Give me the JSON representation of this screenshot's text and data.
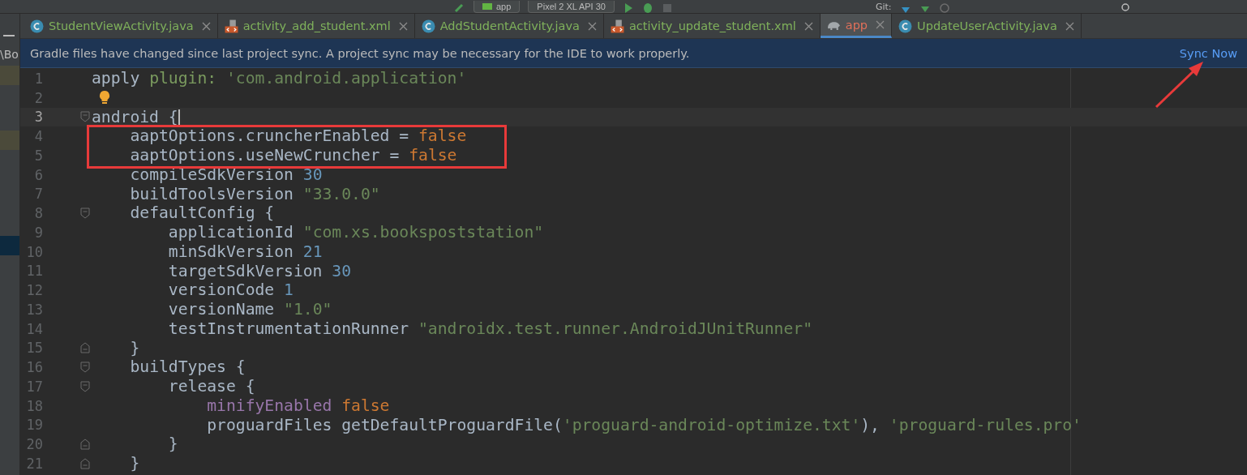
{
  "toolbar": {
    "config": "app",
    "device": "Pixel 2 XL API 30",
    "vcs": "Git:"
  },
  "side_panel": {
    "path_fragment": "\\Bo"
  },
  "tabs": [
    {
      "label": "StudentViewActivity.java",
      "kind": "class",
      "color": "#7fb15b",
      "selected": false
    },
    {
      "label": "activity_add_student.xml",
      "kind": "xml",
      "color": "#7fb15b",
      "selected": false
    },
    {
      "label": "AddStudentActivity.java",
      "kind": "class",
      "color": "#7fb15b",
      "selected": false
    },
    {
      "label": "activity_update_student.xml",
      "kind": "xml",
      "color": "#7fb15b",
      "selected": false
    },
    {
      "label": "app",
      "kind": "gradle",
      "color": "#e0705a",
      "selected": true
    },
    {
      "label": "UpdateUserActivity.java",
      "kind": "class",
      "color": "#7fb15b",
      "selected": false
    }
  ],
  "banner": {
    "message": "Gradle files have changed since last project sync. A project sync may be necessary for the IDE to work properly.",
    "action": "Sync Now"
  },
  "editor": {
    "lines": [
      {
        "number": "1",
        "current": false,
        "boxed": false,
        "segments": [
          {
            "text": "apply ",
            "kind": "plain"
          },
          {
            "text": "plugin: ",
            "kind": "label"
          },
          {
            "text": "'com.android.application'",
            "kind": "string"
          }
        ]
      },
      {
        "number": "2",
        "current": false,
        "boxed": false,
        "segments": [
          {
            "kind": "bulb"
          }
        ]
      },
      {
        "number": "3",
        "current": true,
        "boxed": false,
        "kind": "fold_start",
        "segments": [
          {
            "text": "android {",
            "kind": "plain"
          },
          {
            "kind": "caret"
          }
        ]
      },
      {
        "number": "4",
        "current": false,
        "boxed": true,
        "segments": [
          {
            "text": "    aaptOptions.cruncherEnabled = ",
            "kind": "plain"
          },
          {
            "text": "false",
            "kind": "keyword"
          }
        ]
      },
      {
        "number": "5",
        "current": false,
        "boxed": true,
        "segments": [
          {
            "text": "    aaptOptions.useNewCruncher = ",
            "kind": "plain"
          },
          {
            "text": "false",
            "kind": "keyword"
          }
        ]
      },
      {
        "number": "6",
        "current": false,
        "boxed": false,
        "segments": [
          {
            "text": "    compileSdkVersion ",
            "kind": "plain"
          },
          {
            "text": "30",
            "kind": "number"
          }
        ]
      },
      {
        "number": "7",
        "current": false,
        "boxed": false,
        "segments": [
          {
            "text": "    buildToolsVersion ",
            "kind": "plain"
          },
          {
            "text": "\"33.0.0\"",
            "kind": "string"
          }
        ]
      },
      {
        "number": "8",
        "current": false,
        "boxed": false,
        "kind": "fold_start",
        "segments": [
          {
            "text": "    defaultConfig {",
            "kind": "plain"
          }
        ]
      },
      {
        "number": "9",
        "current": false,
        "boxed": false,
        "segments": [
          {
            "text": "        applicationId ",
            "kind": "plain"
          },
          {
            "text": "\"com.xs.bookspoststation\"",
            "kind": "string"
          }
        ]
      },
      {
        "number": "10",
        "current": false,
        "boxed": false,
        "segments": [
          {
            "text": "        minSdkVersion ",
            "kind": "plain"
          },
          {
            "text": "21",
            "kind": "number"
          }
        ]
      },
      {
        "number": "11",
        "current": false,
        "boxed": false,
        "segments": [
          {
            "text": "        targetSdkVersion ",
            "kind": "plain"
          },
          {
            "text": "30",
            "kind": "number"
          }
        ]
      },
      {
        "number": "12",
        "current": false,
        "boxed": false,
        "segments": [
          {
            "text": "        versionCode ",
            "kind": "plain"
          },
          {
            "text": "1",
            "kind": "number"
          }
        ]
      },
      {
        "number": "13",
        "current": false,
        "boxed": false,
        "segments": [
          {
            "text": "        versionName ",
            "kind": "plain"
          },
          {
            "text": "\"1.0\"",
            "kind": "string"
          }
        ]
      },
      {
        "number": "14",
        "current": false,
        "boxed": false,
        "segments": [
          {
            "text": "        testInstrumentationRunner ",
            "kind": "plain"
          },
          {
            "text": "\"androidx.test.runner.AndroidJUnitRunner\"",
            "kind": "string"
          }
        ]
      },
      {
        "number": "15",
        "current": false,
        "boxed": false,
        "kind": "fold_end",
        "segments": [
          {
            "text": "    }",
            "kind": "plain"
          }
        ]
      },
      {
        "number": "16",
        "current": false,
        "boxed": false,
        "kind": "fold_start",
        "segments": [
          {
            "text": "    buildTypes {",
            "kind": "plain"
          }
        ]
      },
      {
        "number": "17",
        "current": false,
        "boxed": false,
        "kind": "fold_start",
        "segments": [
          {
            "text": "        release {",
            "kind": "plain"
          }
        ]
      },
      {
        "number": "18",
        "current": false,
        "boxed": false,
        "segments": [
          {
            "text": "            minifyEnabled",
            "kind": "property"
          },
          {
            "text": " false",
            "kind": "keyword"
          }
        ]
      },
      {
        "number": "19",
        "current": false,
        "boxed": false,
        "segments": [
          {
            "text": "            proguardFiles getDefaultProguardFile(",
            "kind": "plain"
          },
          {
            "text": "'proguard-android-optimize.txt'",
            "kind": "string"
          },
          {
            "text": "), ",
            "kind": "plain"
          },
          {
            "text": "'proguard-rules.pro'",
            "kind": "string"
          }
        ]
      },
      {
        "number": "20",
        "current": false,
        "boxed": false,
        "kind": "fold_end",
        "segments": [
          {
            "text": "        }",
            "kind": "plain"
          }
        ]
      },
      {
        "number": "21",
        "current": false,
        "boxed": false,
        "kind": "fold_end",
        "segments": [
          {
            "text": "    }",
            "kind": "plain"
          }
        ]
      }
    ]
  }
}
